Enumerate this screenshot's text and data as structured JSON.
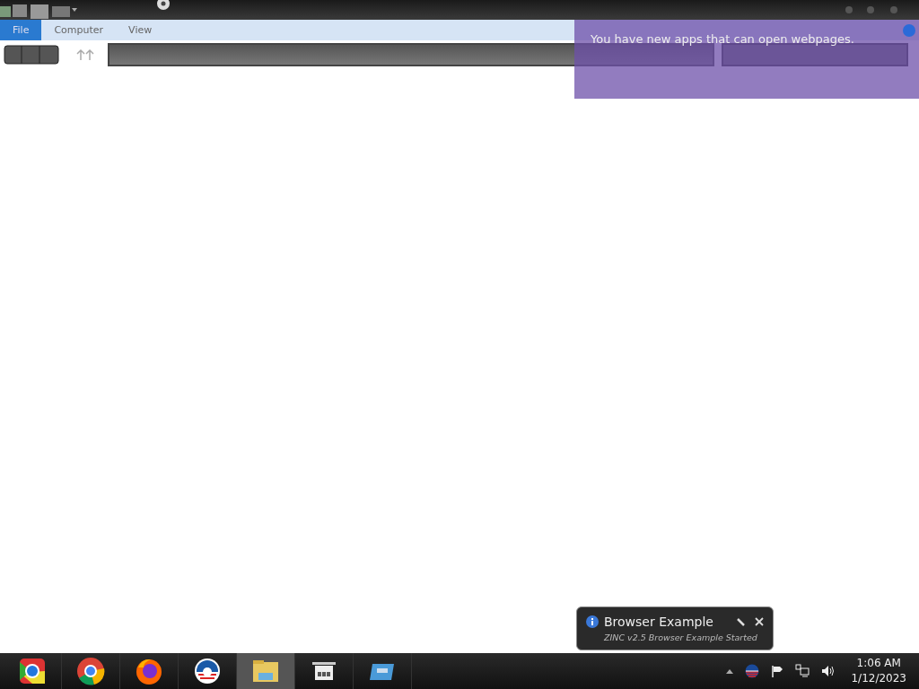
{
  "menu": {
    "tabs": [
      {
        "label": "File",
        "selected": true
      },
      {
        "label": "Computer",
        "selected": false
      },
      {
        "label": "View",
        "selected": false
      }
    ]
  },
  "notification": {
    "message": "You have new apps that can open webpages."
  },
  "balloon": {
    "title": "Browser Example",
    "message": "ZINC v2.5 Browser Example Started"
  },
  "clock": {
    "time": "1:06 AM",
    "date": "1/12/2023"
  }
}
